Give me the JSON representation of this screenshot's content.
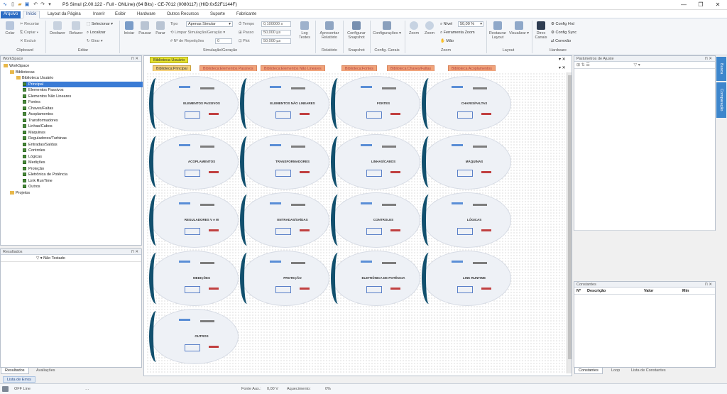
{
  "app_title": "PS Simul (2.00.122 - Full - ONLine) (64 Bits) - CE-7012 (0080117) (HID:0x52F1144F)",
  "window_controls": {
    "minimize": "—",
    "restore": "❐",
    "close": "✕"
  },
  "menu": {
    "file": "Arquivo",
    "tabs": [
      "Início",
      "Layout da Página",
      "Inserir",
      "Exibir",
      "Hardware",
      "Outros Recursos",
      "Suporte",
      "Fabricante"
    ]
  },
  "ribbon": {
    "clipboard": {
      "colar": "Colar",
      "recortar": "Recortar",
      "copiar": "Copiar",
      "excluir": "Excluir",
      "group": "Clipboard"
    },
    "editar": {
      "desfazer": "Desfazer",
      "refazer": "Refazer",
      "selecionar": "Selecionar",
      "localizar": "Localizar",
      "girar": "Girar",
      "group": "Editar"
    },
    "sim": {
      "iniciar": "Iniciar",
      "pausar": "Pausar",
      "parar": "Parar",
      "tipo_label": "Tipo",
      "tipo_value": "Apenas Simular",
      "limpar": "Limpar Simulação/Geração",
      "repeticoes": "Nº de Repetições",
      "repeticoes_value": "0",
      "tempo_label": "Tempo",
      "tempo_value": "0,100000 s",
      "passo_label": "Passo",
      "passo_value": "50,000 µs",
      "plot_label": "Plot",
      "plot_value": "50,000 µs",
      "log": "Log Testes",
      "group": "Simulação/Geração"
    },
    "relatorio": {
      "label": "Apresentar Relatório",
      "group": "Relatório"
    },
    "snapshot": {
      "label": "Configurar Snapshot",
      "group": "Snapshot"
    },
    "config": {
      "label": "Configurações",
      "group": "Config. Gerais"
    },
    "zoom": {
      "zoom_in": "Zoom",
      "zoom_out": "Zoom",
      "nivel_label": "Nível",
      "nivel_value": "50,00 %",
      "ferramenta": "Ferramenta Zoom",
      "mao": "Mão",
      "group": "Zoom"
    },
    "layout": {
      "restaurar": "Restaurar Layout",
      "visualizar": "Visualizar",
      "group": "Layout"
    },
    "hardware": {
      "direc": "Direc Canais",
      "config_hrd": "Config Hrd",
      "config_sync": "Config Sync",
      "conexao": "Conexão",
      "group": "Hardware"
    }
  },
  "workspace": {
    "title": "WorkSpace",
    "tree": [
      {
        "label": "WorkSpace",
        "level": 0,
        "kind": "root"
      },
      {
        "label": "Bibliotecas",
        "level": 1,
        "kind": "folder"
      },
      {
        "label": "Biblioteca Usuário",
        "level": 2,
        "kind": "folder"
      },
      {
        "label": "Principal",
        "level": 3,
        "kind": "item",
        "selected": true
      },
      {
        "label": "Elementos Passivos",
        "level": 3,
        "kind": "item"
      },
      {
        "label": "Elementos Não Lineares",
        "level": 3,
        "kind": "item"
      },
      {
        "label": "Fontes",
        "level": 3,
        "kind": "item"
      },
      {
        "label": "Chaves/Faltas",
        "level": 3,
        "kind": "item"
      },
      {
        "label": "Acoplamentos",
        "level": 3,
        "kind": "item"
      },
      {
        "label": "Transformadores",
        "level": 3,
        "kind": "item"
      },
      {
        "label": "Linhas/Cabos",
        "level": 3,
        "kind": "item"
      },
      {
        "label": "Máquinas",
        "level": 3,
        "kind": "item"
      },
      {
        "label": "Reguladores/Turbinas",
        "level": 3,
        "kind": "item"
      },
      {
        "label": "Entradas/Saídas",
        "level": 3,
        "kind": "item"
      },
      {
        "label": "Controles",
        "level": 3,
        "kind": "item"
      },
      {
        "label": "Lógicas",
        "level": 3,
        "kind": "item"
      },
      {
        "label": "Medições",
        "level": 3,
        "kind": "item"
      },
      {
        "label": "Proteção",
        "level": 3,
        "kind": "item"
      },
      {
        "label": "Eletrônica de Potência",
        "level": 3,
        "kind": "item"
      },
      {
        "label": "Link RunTime",
        "level": 3,
        "kind": "item"
      },
      {
        "label": "Outros",
        "level": 3,
        "kind": "item"
      },
      {
        "label": "Projetos",
        "level": 1,
        "kind": "folder"
      }
    ]
  },
  "results": {
    "title": "Resultados",
    "filter": "Não Testado",
    "tabs": [
      "Resultados",
      "Avaliações"
    ]
  },
  "document": {
    "tab": "Biblioteca Usuário",
    "sub_tabs": [
      "Biblioteca:Principal",
      "Biblioteca:Elementos Passivos",
      "Biblioteca:Elementos Não Lineares",
      "Biblioteca:Fontes",
      "Biblioteca:Chaves/Faltas",
      "Biblioteca:Acoplamentos"
    ],
    "cards": [
      "ELEMENTOS PASSIVOS",
      "ELEMENTOS NÃO LINEARES",
      "FONTES",
      "CHAVES/FALTAS",
      "ACOPLAMENTOS",
      "TRANSFORMADORES",
      "LINHAS/CABOS",
      "MÁQUINAS",
      "REGULADORES V e W",
      "ENTRADAS/SAÍDAS",
      "CONTROLES",
      "LÓGICAS",
      "MEDIÇÕES",
      "PROTEÇÃO",
      "ELETRÔNICA DE POTÊNCIA",
      "LINK RUNTIME",
      "OUTROS"
    ]
  },
  "params": {
    "title": "Parâmetros de Ajuste"
  },
  "constants": {
    "title": "Constantes",
    "columns": [
      "Nº",
      "Descrição",
      "Valor",
      "Mín"
    ],
    "tabs": [
      "Constantes",
      "Loop",
      "Lista de Constantes"
    ]
  },
  "side_tabs": [
    "Busca",
    "Comparação"
  ],
  "errors_tab": "Lista de Erros",
  "status": {
    "line": "OFF Line",
    "fonte": "Fonte Aux.:",
    "fonte_value": "0,00 V",
    "aquec": "Aquecimento:",
    "aquec_value": "0%"
  }
}
